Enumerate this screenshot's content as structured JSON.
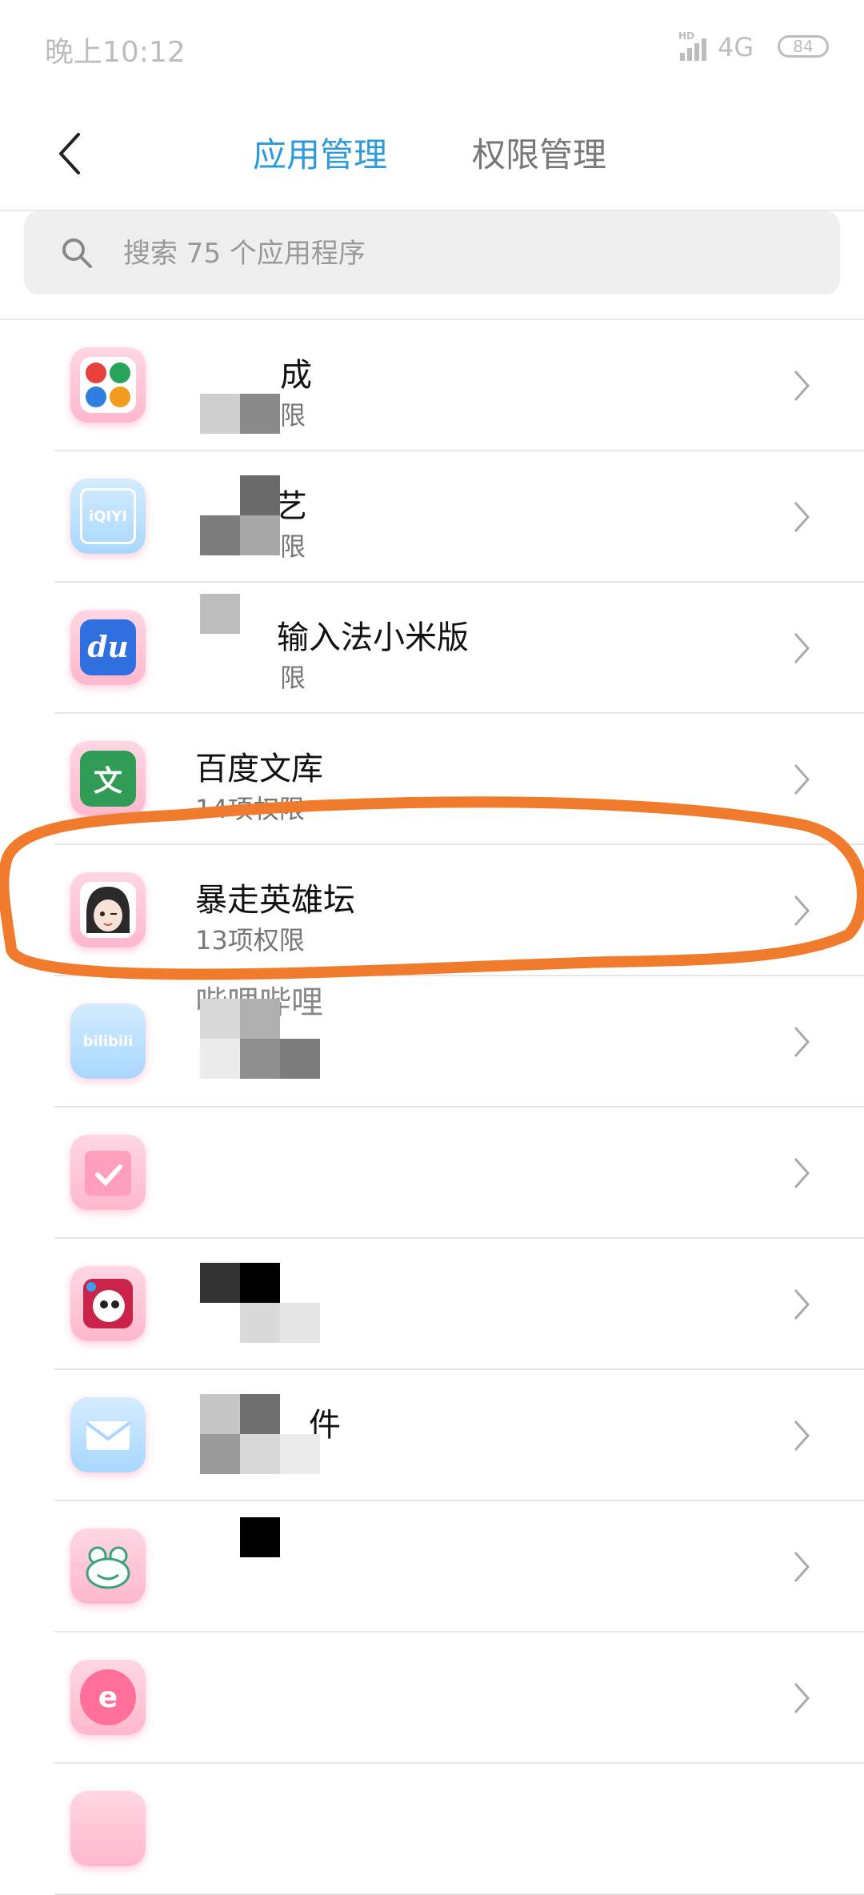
{
  "status_bar": {
    "time": "晚上10:12",
    "network": "4G",
    "signal_badge": "HD",
    "battery": "84"
  },
  "header": {
    "tab_app_manage": "应用管理",
    "tab_permission_manage": "权限管理"
  },
  "search": {
    "placeholder": "搜索 75 个应用程序"
  },
  "apps": [
    {
      "name": "成",
      "perm": "限",
      "icon": "grid-icon"
    },
    {
      "name": "艺",
      "perm": "限",
      "icon": "iqiyi-icon",
      "icon_text": "iQIYI"
    },
    {
      "name": "输入法小米版",
      "perm": "限",
      "icon": "baidu-icon",
      "icon_text": "du"
    },
    {
      "name": "百度文库",
      "perm": "14项权限",
      "icon": "wenku-icon",
      "icon_text": "文"
    },
    {
      "name": "暴走英雄坛",
      "perm": "13项权限",
      "icon": "avatar-icon"
    },
    {
      "name": "哔哩哔哩",
      "perm": "",
      "icon": "bilibili-icon",
      "icon_text": "bilibili"
    },
    {
      "name": "",
      "perm": "",
      "icon": "calendar-check-icon"
    },
    {
      "name": "",
      "perm": "",
      "icon": "panda-icon"
    },
    {
      "name": "件",
      "perm": "",
      "icon": "mail-icon"
    },
    {
      "name": "",
      "perm": "",
      "icon": "frog-icon"
    },
    {
      "name": "",
      "perm": "",
      "icon": "e-icon",
      "icon_text": "e"
    }
  ],
  "colors": {
    "accent": "#2e9adb",
    "annotation": "#f07b2d"
  }
}
